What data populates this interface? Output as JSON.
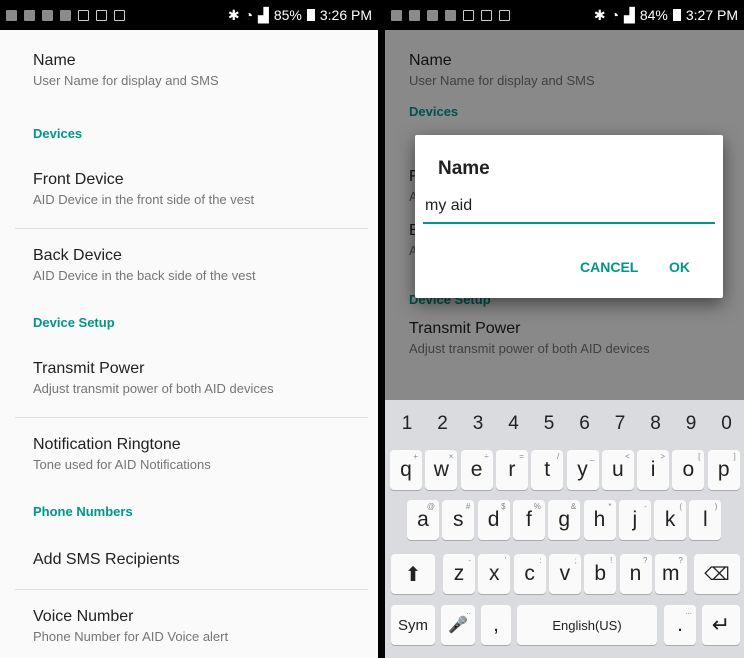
{
  "left": {
    "status": {
      "battery": "85%",
      "time": "3:26 PM"
    },
    "items": [
      {
        "type": "item",
        "title": "Name",
        "summary": "User Name for display and SMS"
      },
      {
        "type": "cat",
        "title": "Devices"
      },
      {
        "type": "item",
        "title": "Front Device",
        "summary": "AID Device in the front side of the vest"
      },
      {
        "type": "item",
        "title": "Back Device",
        "summary": "AID Device in the back side of the vest"
      },
      {
        "type": "cat",
        "title": "Device Setup"
      },
      {
        "type": "item",
        "title": "Transmit Power",
        "summary": "Adjust transmit power of both AID devices"
      },
      {
        "type": "item",
        "title": "Notification Ringtone",
        "summary": "Tone used for AID Notifications"
      },
      {
        "type": "cat",
        "title": "Phone Numbers"
      },
      {
        "type": "item",
        "title": "Add SMS Recipients",
        "summary": ""
      },
      {
        "type": "item",
        "title": "Voice Number",
        "summary": "Phone Number for AID Voice alert"
      }
    ]
  },
  "right": {
    "status": {
      "battery": "84%",
      "time": "3:27 PM"
    },
    "items": [
      {
        "title": "Name",
        "summary": "User Name for display and SMS"
      },
      {
        "cat": "Devices"
      },
      {
        "title": "F",
        "summary": "A"
      },
      {
        "title": "B",
        "summary": "A"
      },
      {
        "cat": "Device Setup"
      },
      {
        "title": "Transmit Power",
        "summary": "Adjust transmit power of both AID devices"
      }
    ],
    "dialog": {
      "title": "Name",
      "value": "my aid",
      "cancel": "CANCEL",
      "ok": "OK"
    },
    "keyboard": {
      "numbers": [
        "1",
        "2",
        "3",
        "4",
        "5",
        "6",
        "7",
        "8",
        "9",
        "0"
      ],
      "row1": [
        [
          "q",
          "+"
        ],
        [
          "w",
          "×"
        ],
        [
          "e",
          "÷"
        ],
        [
          "r",
          "="
        ],
        [
          "t",
          "/"
        ],
        [
          "y",
          "_"
        ],
        [
          "u",
          "<"
        ],
        [
          "i",
          ">"
        ],
        [
          "o",
          "["
        ],
        [
          "p",
          "]"
        ]
      ],
      "row2": [
        [
          "a",
          "@"
        ],
        [
          "s",
          "#"
        ],
        [
          "d",
          "$"
        ],
        [
          "f",
          "%"
        ],
        [
          "g",
          "&"
        ],
        [
          "h",
          "*"
        ],
        [
          "j",
          "-"
        ],
        [
          "k",
          "("
        ],
        [
          "l",
          ")"
        ]
      ],
      "row3": [
        [
          "z",
          "-"
        ],
        [
          "x",
          "'"
        ],
        [
          "c",
          ":"
        ],
        [
          "v",
          ";"
        ],
        [
          "b",
          "!"
        ],
        [
          "n",
          "?"
        ],
        [
          "m",
          "?"
        ]
      ],
      "sym": "Sym",
      "comma": ",",
      "space": "English(US)",
      "period": "."
    }
  }
}
